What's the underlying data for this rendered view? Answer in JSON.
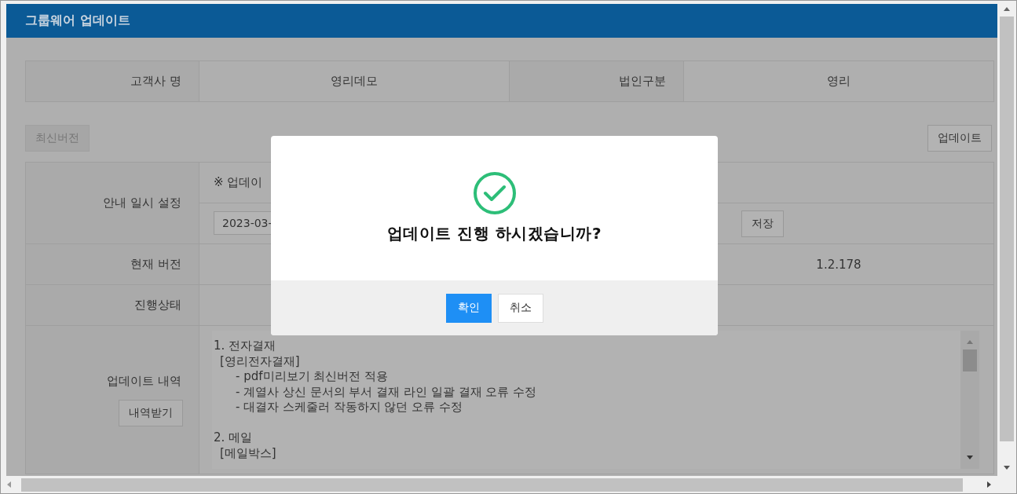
{
  "window": {
    "title": "그룹웨어 업데이트"
  },
  "info": {
    "fields": [
      {
        "label": "고객사 명",
        "value": "영리데모"
      },
      {
        "label": "법인구분",
        "value": "영리"
      }
    ]
  },
  "toolbar": {
    "left_button": "최신버전",
    "right_button": "업데이트"
  },
  "schedule": {
    "label": "안내 일시 설정",
    "notice": "※ 업데이",
    "date": "2023-03-",
    "save_button": "저장"
  },
  "version": {
    "label": "현재 버전",
    "value": "1.2.178"
  },
  "status": {
    "label": "진행상태"
  },
  "history": {
    "label": "업데이트 내역",
    "button": "내역받기",
    "sections": [
      {
        "title": "1. 전자결재",
        "groups": [
          {
            "title": "[영리전자결재]",
            "items": [
              "- pdf미리보기 최신버전 적용",
              "- 계열사 상신 문서의 부서 결재 라인 일괄 결재 오류 수정",
              "- 대결자 스케줄러 작동하지 않던 오류 수정"
            ]
          }
        ]
      },
      {
        "title": "2. 메일",
        "groups": [
          {
            "title": "[메일박스]"
          }
        ]
      }
    ]
  },
  "dialog": {
    "message": "업데이트 진행 하시겠습니까?",
    "buttons": [
      {
        "label": "확인",
        "primary": true
      },
      {
        "label": "취소",
        "primary": false
      }
    ]
  }
}
